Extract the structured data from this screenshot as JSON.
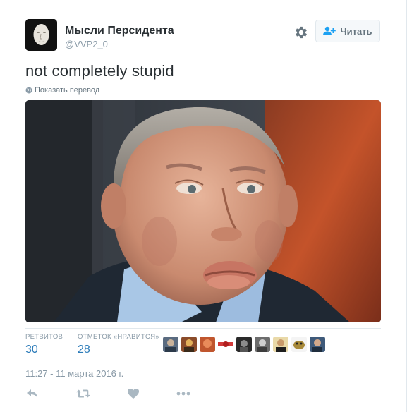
{
  "user": {
    "name": "Мысли Персидента",
    "handle": "@VVP2_0"
  },
  "header": {
    "settings_icon": "gear-icon",
    "follow_label": "Читать",
    "follow_icon": "add-user-icon"
  },
  "tweet": {
    "text": "not completely stupid",
    "translate_label": "Показать перевод",
    "translate_icon": "globe-icon"
  },
  "stats": {
    "retweets_label": "РЕТВИТОВ",
    "retweets_count": "30",
    "likes_label": "ОТМЕТОК «НРАВИТСЯ»",
    "likes_count": "28"
  },
  "timestamp": "11:27 - 11 марта 2016 г.",
  "actions": [
    "reply-icon",
    "retweet-icon",
    "like-icon",
    "more-icon"
  ],
  "colors": {
    "link": "#2b7bb9",
    "muted": "#8899a6",
    "text": "#292f33",
    "border": "#e1e8ed"
  }
}
